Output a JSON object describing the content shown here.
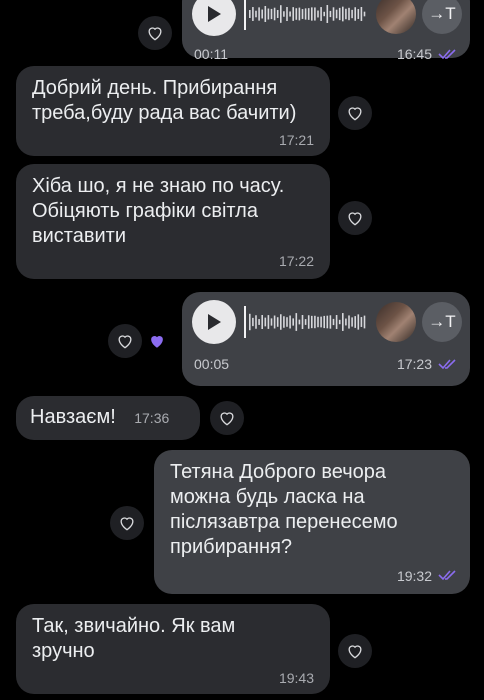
{
  "messages": [
    {
      "id": "v1",
      "type": "voice",
      "dir": "out",
      "duration": "00:11",
      "time": "16:45"
    },
    {
      "id": "m1",
      "type": "text",
      "dir": "in",
      "text": "Добрий день. Прибирання\nтреба,буду рада вас бачити)",
      "time": "17:21"
    },
    {
      "id": "m2",
      "type": "text",
      "dir": "in",
      "text": "Хіба шо, я не знаю по часу.\nОбіцяють графіки світла\nвиставити",
      "time": "17:22"
    },
    {
      "id": "v2",
      "type": "voice",
      "dir": "out",
      "duration": "00:05",
      "time": "17:23"
    },
    {
      "id": "m3",
      "type": "text",
      "dir": "in",
      "text": "Навзаєм!",
      "time": "17:36"
    },
    {
      "id": "m4",
      "type": "text",
      "dir": "out",
      "text": "Тетяна Доброго вечора\nможна будь ласка на\nпіслязавтра перенесемо\nприбирання?",
      "time": "19:32"
    },
    {
      "id": "m5",
      "type": "text",
      "dir": "in",
      "text": "Так, звичайно. Як вам\nзручно",
      "time": "19:43"
    }
  ],
  "voice_controls": {
    "transcribe_label": "→T"
  },
  "icons": {
    "reaction": "heart-outline-icon",
    "reaction_active": "heart-filled-icon",
    "read_receipt": "double-check-icon",
    "play": "play-icon"
  },
  "colors": {
    "accent": "#8b6cf0",
    "incoming_bubble": "#2b2c30",
    "outgoing_bubble": "#3f4146",
    "background": "#000000"
  }
}
